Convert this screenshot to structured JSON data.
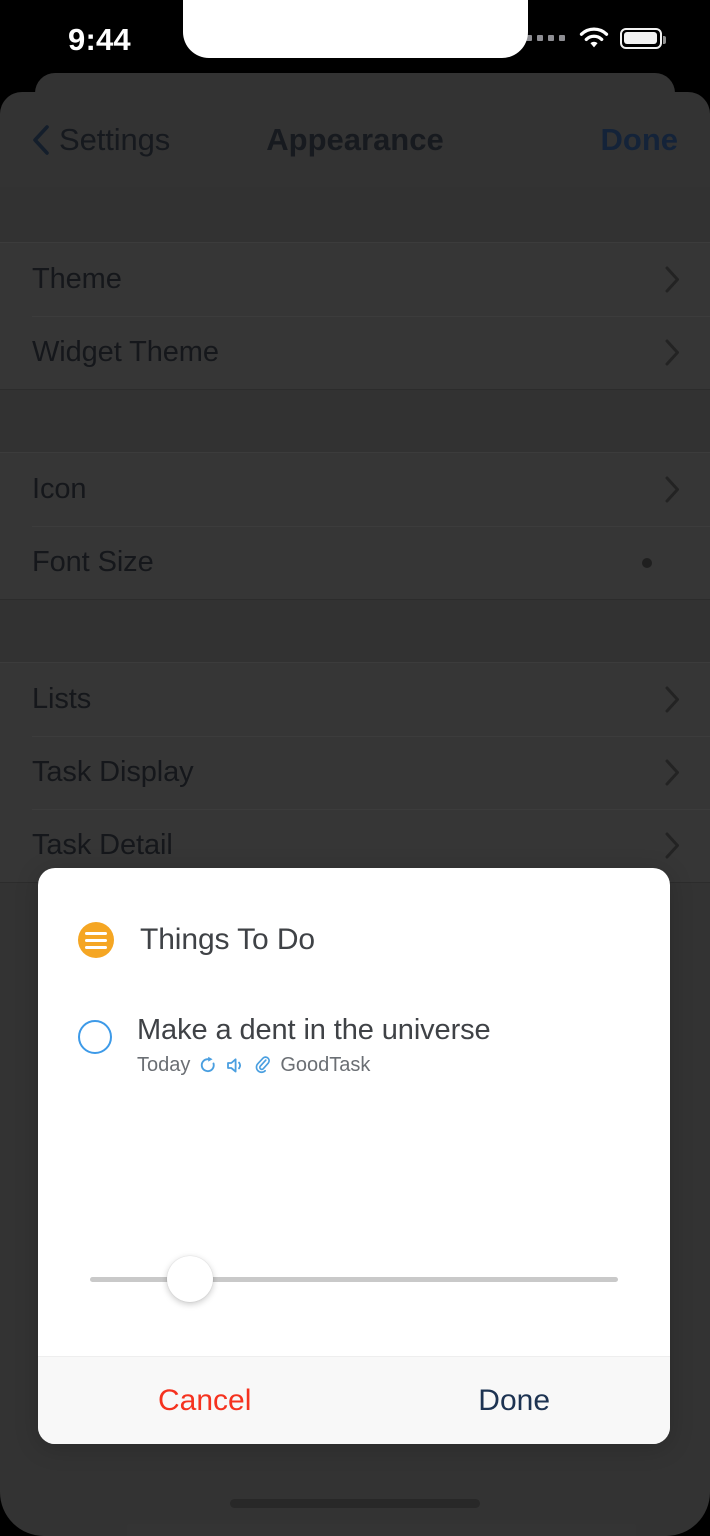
{
  "status_bar": {
    "time": "9:44",
    "signal_icon": "signal-dots-icon",
    "wifi_icon": "wifi-icon",
    "battery_icon": "battery-icon"
  },
  "nav": {
    "back_icon": "chevron-left-icon",
    "back_label": "Settings",
    "title": "Appearance",
    "done_label": "Done"
  },
  "settings": {
    "groups": [
      {
        "rows": [
          {
            "label": "Theme",
            "accessory": "chevron-right-icon"
          },
          {
            "label": "Widget Theme",
            "accessory": "chevron-right-icon"
          }
        ]
      },
      {
        "rows": [
          {
            "label": "Icon",
            "accessory": "chevron-right-icon"
          },
          {
            "label": "Font Size",
            "accessory": "slider-dot-icon"
          }
        ]
      },
      {
        "rows": [
          {
            "label": "Lists",
            "accessory": "chevron-right-icon"
          },
          {
            "label": "Task Display",
            "accessory": "chevron-right-icon"
          },
          {
            "label": "Task Detail",
            "accessory": "chevron-right-icon"
          }
        ]
      }
    ]
  },
  "modal": {
    "list": {
      "icon": "list-bullet-icon",
      "icon_color": "#f5a623",
      "name": "Things To Do"
    },
    "task": {
      "checkbox_icon": "circle-unchecked-icon",
      "checkbox_color": "#3d9ae8",
      "title": "Make a dent in the universe",
      "meta": {
        "date": "Today",
        "repeat_icon": "repeat-icon",
        "alert_icon": "speaker-alert-icon",
        "attachment_icon": "paperclip-icon",
        "source": "GoodTask"
      }
    },
    "font_size_slider": {
      "name": "font-size-slider",
      "value_percent": 19,
      "min": 0,
      "max": 100,
      "track_color": "#c9c9c9",
      "thumb_color": "#ffffff"
    },
    "footer": {
      "cancel_label": "Cancel",
      "cancel_color": "#f5321f",
      "done_label": "Done",
      "done_color": "#1d3352"
    }
  },
  "home_indicator": "home-indicator"
}
